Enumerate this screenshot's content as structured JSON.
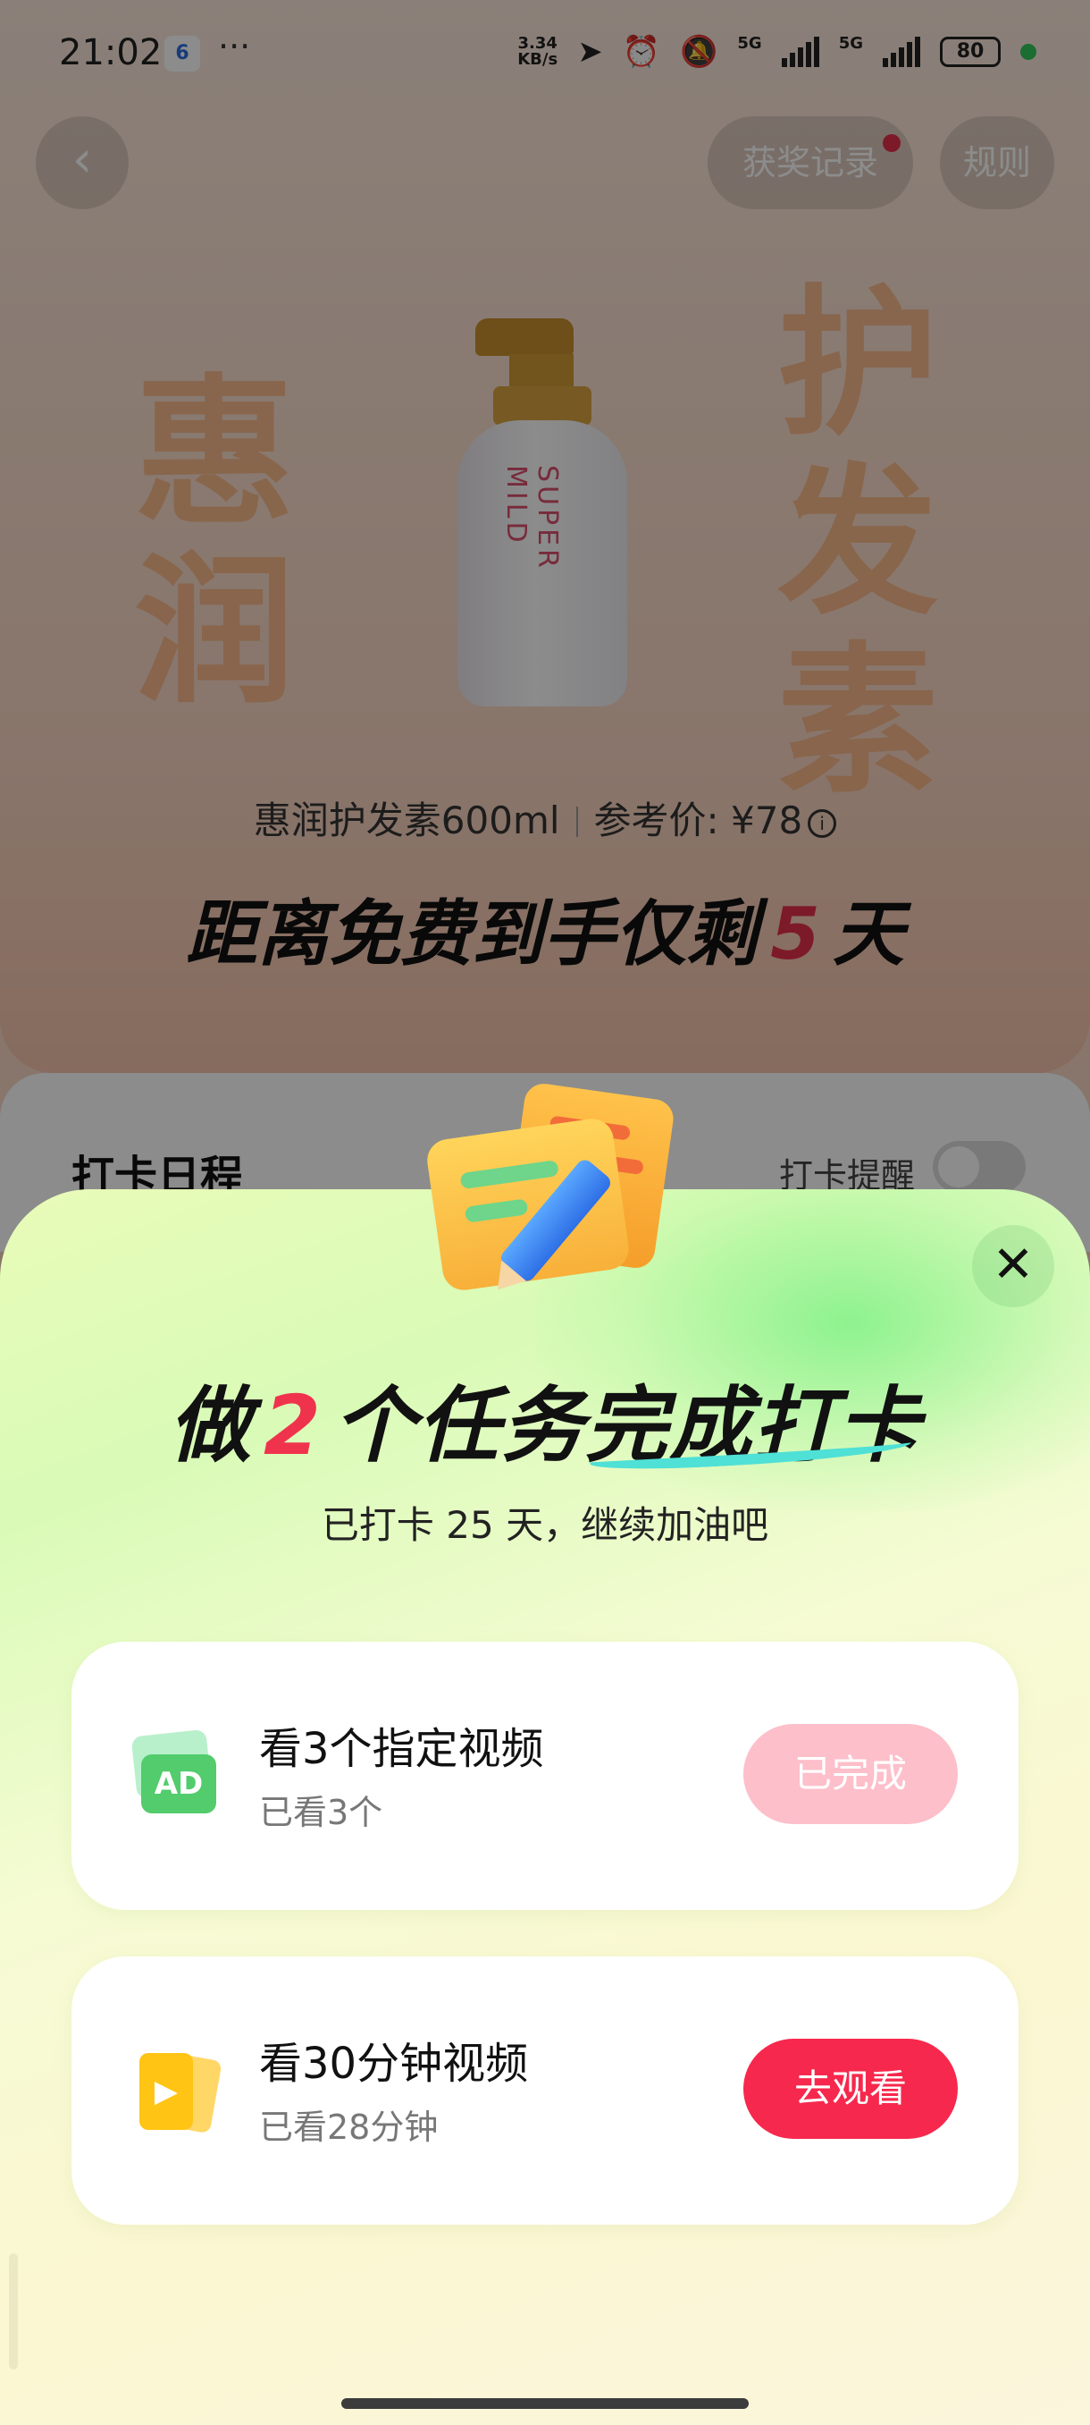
{
  "status_bar": {
    "time": "21:02",
    "app_badge": "6",
    "more": "···",
    "net_speed_value": "3.34",
    "net_speed_unit": "KB/s",
    "network_label": "5G",
    "battery": "80"
  },
  "header": {
    "back_icon": "‹",
    "prize_record_label": "获奖记录",
    "rules_label": "规则"
  },
  "hero": {
    "deco_left": [
      "惠",
      "润"
    ],
    "deco_right": [
      "护",
      "发",
      "素"
    ],
    "bottle_text": "SUPER MILD",
    "product_name": "惠润护发素600ml",
    "reference_price": "参考价: ¥78",
    "info_icon": "i",
    "countdown_prefix": "距离免费到手仅剩",
    "countdown_days": "5",
    "countdown_suffix": "天"
  },
  "checkin": {
    "title": "打卡日程",
    "reminder_label": "打卡提醒"
  },
  "sheet": {
    "close_icon": "✕",
    "title_prefix": "做",
    "title_number": "2",
    "title_suffix": "个任务完成打卡",
    "subtitle": "已打卡 25 天，继续加油吧",
    "tasks": [
      {
        "icon_text": "AD",
        "icon_name": "ad-video-icon",
        "title": "看3个指定视频",
        "progress": "已看3个",
        "button_label": "已完成",
        "status": "done"
      },
      {
        "icon_text": "▶",
        "icon_name": "play-video-icon",
        "title": "看30分钟视频",
        "progress": "已看28分钟",
        "button_label": "去观看",
        "status": "pending"
      }
    ]
  },
  "colors": {
    "accent_red": "#f7284d",
    "done_pink": "#fdbfca",
    "sheet_green": "#d9fbb7",
    "swoosh_teal": "#4fe0d6"
  }
}
